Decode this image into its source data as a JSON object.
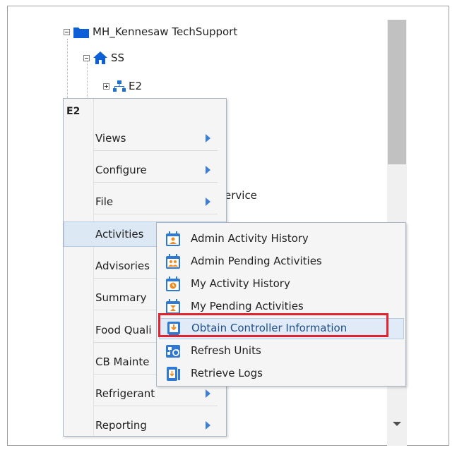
{
  "tree": {
    "root_label": "MH_Kennesaw TechSupport",
    "site_label": "SS",
    "unit_label": "E2",
    "partial_text": "ervice"
  },
  "context_menu": {
    "header": "E2",
    "items": [
      {
        "label": "Views",
        "has_submenu": true
      },
      {
        "label": "Configure",
        "has_submenu": true
      },
      {
        "label": "File",
        "has_submenu": true
      },
      {
        "label": "Activities",
        "has_submenu": true,
        "active": true
      },
      {
        "label": "Advisories",
        "has_submenu": true
      },
      {
        "label": "Summary",
        "has_submenu": true
      },
      {
        "label": "Food Quali",
        "has_submenu": true
      },
      {
        "label": "CB Mainte",
        "has_submenu": true
      },
      {
        "label": "Refrigerant",
        "has_submenu": true
      },
      {
        "label": "Reporting",
        "has_submenu": true
      }
    ]
  },
  "activities_submenu": {
    "items": [
      {
        "label": "Admin Activity History",
        "icon": "calendar-person-icon"
      },
      {
        "label": "Admin Pending Activities",
        "icon": "calendar-people-icon"
      },
      {
        "label": "My Activity History",
        "icon": "calendar-history-icon"
      },
      {
        "label": "My Pending Activities",
        "icon": "calendar-hourglass-icon"
      },
      {
        "label": "Obtain Controller Information",
        "icon": "controller-download-icon",
        "active": true,
        "highlighted": true
      },
      {
        "label": "Refresh Units",
        "icon": "refresh-units-icon"
      },
      {
        "label": "Retrieve Logs",
        "icon": "retrieve-logs-icon"
      }
    ]
  },
  "colors": {
    "accent": "#3b7fd8",
    "highlight_outline": "#e0242f",
    "active_bg": "#dde8f5",
    "icon_blue": "#2f79d4",
    "icon_orange": "#f28b1e"
  }
}
